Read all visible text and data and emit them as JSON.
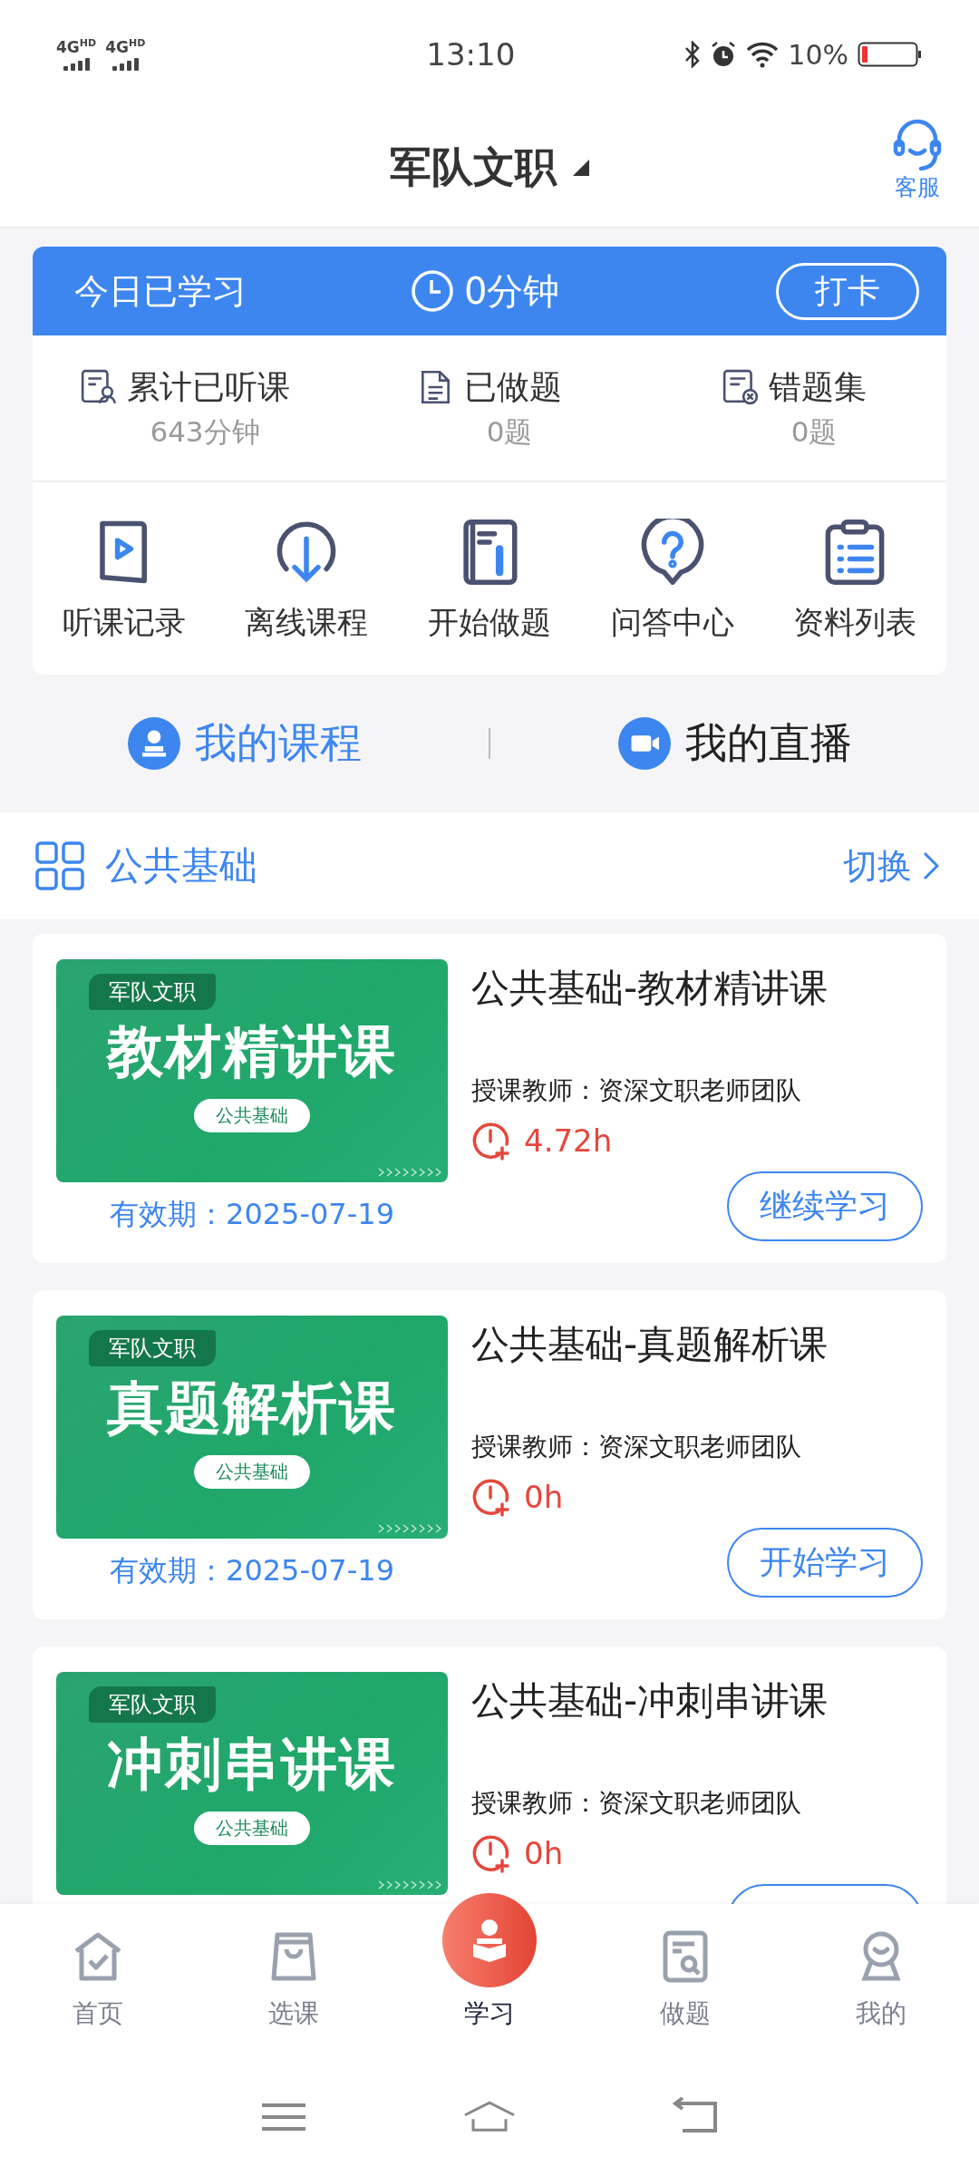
{
  "status_bar": {
    "networks": [
      "4G$^{HD}$",
      "4G$^{HD}$"
    ],
    "time": "13:10",
    "battery": "10%"
  },
  "header": {
    "title": "军队文职",
    "support": "客服"
  },
  "study_bar": {
    "label": "今日已学习",
    "time": "0分钟",
    "button": "打卡"
  },
  "stats": [
    {
      "kind": "listened",
      "label": "累计已听课",
      "value": "643分钟"
    },
    {
      "kind": "done",
      "label": "已做题",
      "value": "0题"
    },
    {
      "kind": "wrong",
      "label": "错题集",
      "value": "0题"
    }
  ],
  "shortcuts": [
    {
      "kind": "play",
      "label": "听课记录"
    },
    {
      "kind": "download",
      "label": "离线课程"
    },
    {
      "kind": "notebook",
      "label": "开始做题"
    },
    {
      "kind": "question",
      "label": "问答中心"
    },
    {
      "kind": "list",
      "label": "资料列表"
    }
  ],
  "tabs": [
    {
      "kind": "course",
      "label": "我的课程",
      "selected": true
    },
    {
      "kind": "live",
      "label": "我的直播",
      "selected": false
    }
  ],
  "section": {
    "title": "公共基础",
    "action": "切换"
  },
  "courses": [
    {
      "banner": {
        "tag": "军队文职",
        "title": "教材精讲课",
        "subject": "公共基础"
      },
      "title": "公共基础-教材精讲课",
      "teacher": "授课教师：资深文职老师团队",
      "duration": "4.72h",
      "valid": "有效期：2025-07-19",
      "button": "继续学习"
    },
    {
      "banner": {
        "tag": "军队文职",
        "title": "真题解析课",
        "subject": "公共基础"
      },
      "title": "公共基础-真题解析课",
      "teacher": "授课教师：资深文职老师团队",
      "duration": "0h",
      "valid": "有效期：2025-07-19",
      "button": "开始学习"
    },
    {
      "banner": {
        "tag": "军队文职",
        "title": "冲刺串讲课",
        "subject": "公共基础"
      },
      "title": "公共基础-冲刺串讲课",
      "teacher": "授课教师：资深文职老师团队",
      "duration": "0h"
    }
  ],
  "nav": [
    {
      "kind": "home",
      "label": "首页",
      "selected": false
    },
    {
      "kind": "bag",
      "label": "选课",
      "selected": false
    },
    {
      "kind": "study",
      "label": "学习",
      "selected": true
    },
    {
      "kind": "exam",
      "label": "做题",
      "selected": false
    },
    {
      "kind": "me",
      "label": "我的",
      "selected": false
    }
  ]
}
